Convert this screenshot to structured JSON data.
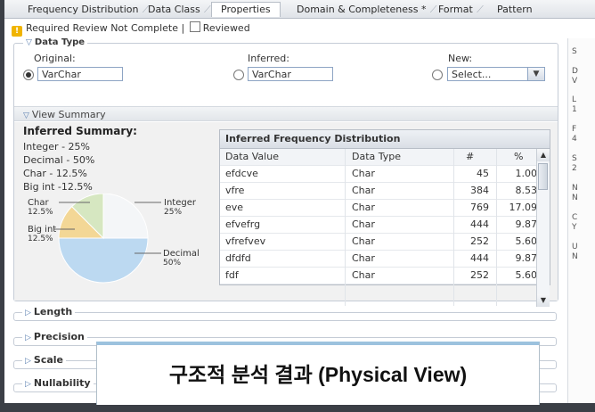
{
  "tabs": [
    "Frequency Distribution",
    "Data Class",
    "Properties",
    "Domain & Completeness *",
    "Format",
    "Pattern"
  ],
  "active_tab": "Properties",
  "review": {
    "required_text": "Required Review Not Complete |",
    "reviewed_label": "Reviewed"
  },
  "data_type": {
    "legend": "Data Type",
    "original_label": "Original:",
    "original_value": "VarChar",
    "inferred_label": "Inferred:",
    "inferred_value": "VarChar",
    "new_label": "New:",
    "new_value": "Select..."
  },
  "view_summary": "View Summary",
  "inferred_summary": {
    "title": "Inferred Summary:",
    "lines": [
      "Integer - 25%",
      "Decimal - 50%",
      "Char - 12.5%",
      "Big int -12.5%"
    ]
  },
  "chart_data": {
    "type": "pie",
    "categories": [
      "Integer",
      "Decimal",
      "Char",
      "Big int"
    ],
    "values": [
      25,
      50,
      12.5,
      12.5
    ],
    "slice_labels": [
      {
        "name": "Char",
        "pct": "12.5%"
      },
      {
        "name": "Big int",
        "pct": "12.5%"
      },
      {
        "name": "Integer",
        "pct": "25%"
      },
      {
        "name": "Decimal",
        "pct": "50%"
      }
    ],
    "colors": {
      "Integer": "#f4f6f8",
      "Decimal": "#bcd9f1",
      "Char": "#f3d796",
      "Big int": "#d6e7c1"
    }
  },
  "freq_table": {
    "title": "Inferred Frequency Distribution",
    "columns": [
      "Data Value",
      "Data Type",
      "#",
      "%"
    ],
    "rows": [
      [
        "efdcve",
        "Char",
        "45",
        "1.00"
      ],
      [
        "vfre",
        "Char",
        "384",
        "8.53"
      ],
      [
        "eve",
        "Char",
        "769",
        "17.09"
      ],
      [
        "efvefrg",
        "Char",
        "444",
        "9.87"
      ],
      [
        "vfrefvev",
        "Char",
        "252",
        "5.60"
      ],
      [
        "dfdfd",
        "Char",
        "444",
        "9.87"
      ],
      [
        "fdf",
        "Char",
        "252",
        "5.60"
      ]
    ]
  },
  "sections": [
    "Length",
    "Precision",
    "Scale",
    "Nullability"
  ],
  "right_pane": [
    "S",
    "D",
    "V",
    "L",
    "1",
    "F",
    "4",
    "S",
    "2",
    "N",
    "N",
    "C",
    "Y",
    "U",
    "N"
  ],
  "caption": "구조적 분석 결과 (Physical View)"
}
